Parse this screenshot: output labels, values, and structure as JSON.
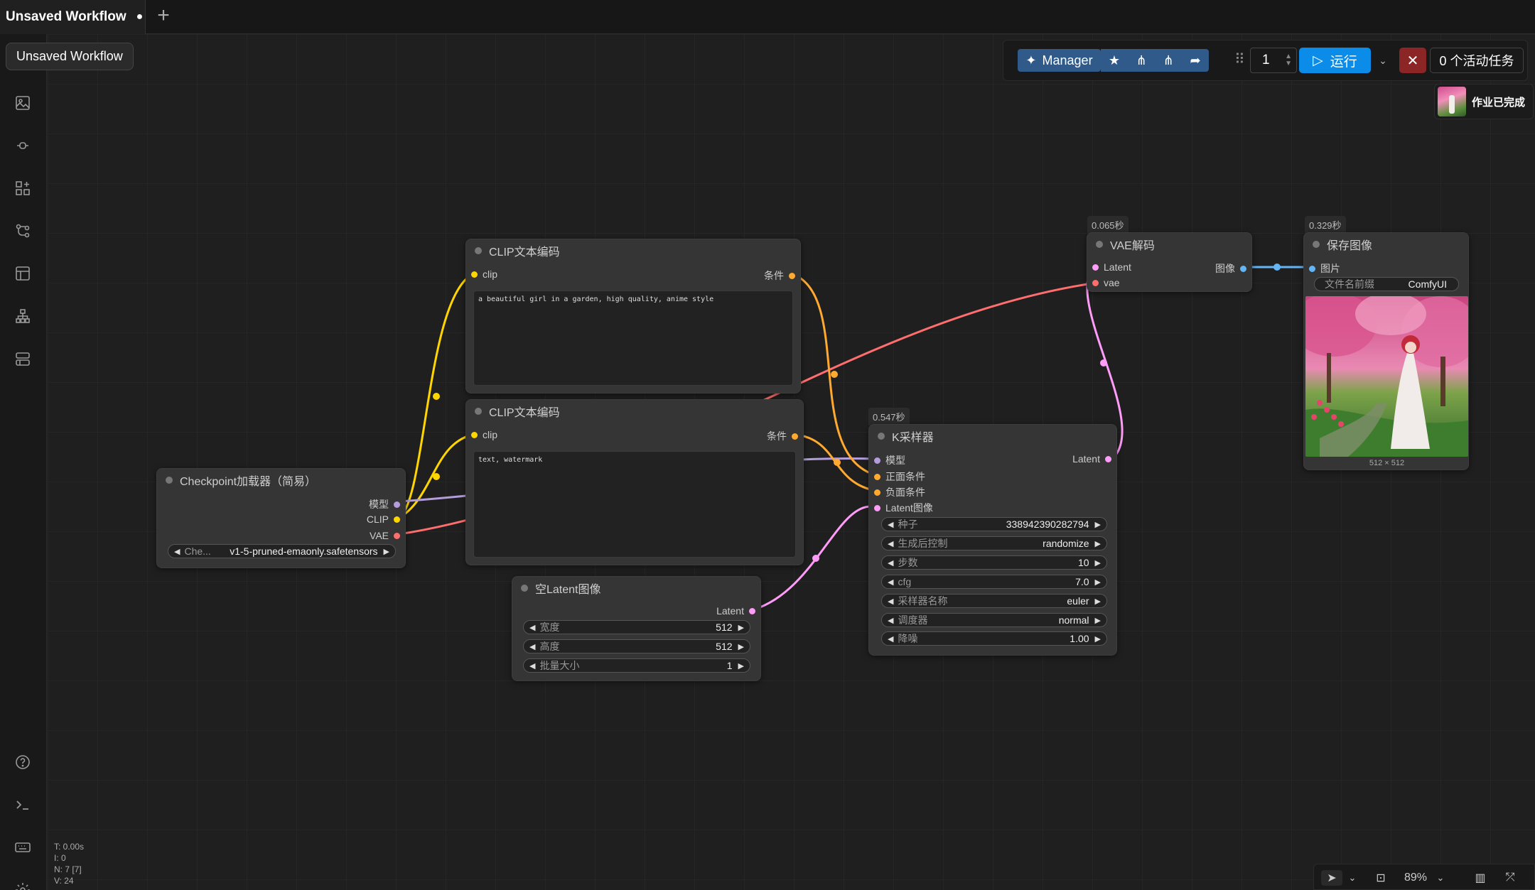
{
  "tab": {
    "title": "Unsaved Workflow",
    "modified_marker": "●",
    "new_tab": "+"
  },
  "tooltip": "Unsaved Workflow",
  "toolbar": {
    "manager_label": "Manager",
    "batch_count": "1",
    "run_label": "运行",
    "queue_label": "0 个活动任务"
  },
  "notification": {
    "text": "作业已完成"
  },
  "nodes": {
    "clip_pos": {
      "title": "CLIP文本编码",
      "input": "clip",
      "output": "条件",
      "text": "a beautiful girl in a garden, high quality, anime style"
    },
    "clip_neg": {
      "title": "CLIP文本编码",
      "input": "clip",
      "output": "条件",
      "text": "text, watermark"
    },
    "checkpoint": {
      "title": "Checkpoint加载器（简易）",
      "outputs": [
        "模型",
        "CLIP",
        "VAE"
      ],
      "widget_label": "Che...",
      "widget_value": "v1-5-pruned-emaonly.safetensors"
    },
    "latent": {
      "title": "空Latent图像",
      "output": "Latent",
      "widgets": [
        {
          "label": "宽度",
          "value": "512"
        },
        {
          "label": "高度",
          "value": "512"
        },
        {
          "label": "批量大小",
          "value": "1"
        }
      ]
    },
    "ksampler": {
      "timing": "0.547秒",
      "title": "K采样器",
      "inputs": [
        "模型",
        "正面条件",
        "负面条件",
        "Latent图像"
      ],
      "output": "Latent",
      "widgets": [
        {
          "label": "种子",
          "value": "338942390282794"
        },
        {
          "label": "生成后控制",
          "value": "randomize"
        },
        {
          "label": "步数",
          "value": "10"
        },
        {
          "label": "cfg",
          "value": "7.0"
        },
        {
          "label": "采样器名称",
          "value": "euler"
        },
        {
          "label": "调度器",
          "value": "normal"
        },
        {
          "label": "降噪",
          "value": "1.00"
        }
      ]
    },
    "vae": {
      "timing": "0.065秒",
      "title": "VAE解码",
      "inputs": [
        "Latent",
        "vae"
      ],
      "output": "图像"
    },
    "save": {
      "timing": "0.329秒",
      "title": "保存图像",
      "input": "图片",
      "prefix_label": "文件名前缀",
      "prefix_value": "ComfyUI",
      "size": "512 × 512"
    }
  },
  "stats": [
    "T: 0.00s",
    "I: 0",
    "N: 7 [7]",
    "V: 24"
  ],
  "zoom": "89%",
  "colors": {
    "clip": "#ffd500",
    "conditioning": "#ffa931",
    "model": "#b39ddb",
    "vae": "#ff6e6e",
    "latent": "#ff9cf9",
    "image": "#64b5f6",
    "run": "#0b8ce9"
  }
}
